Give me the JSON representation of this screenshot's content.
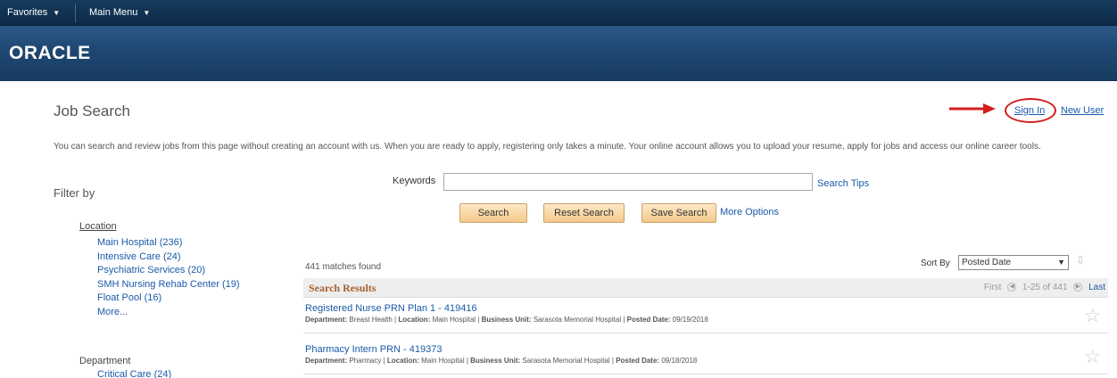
{
  "topnav": {
    "favorites": "Favorites",
    "main_menu": "Main Menu"
  },
  "brand": {
    "logo": "ORACLE"
  },
  "page": {
    "title": "Job Search",
    "sign_in": "Sign In",
    "new_user": "New User",
    "intro": "You can search and review jobs from this page without creating an account with us. When you are ready to apply, registering only takes a minute. Your online account allows you to upload your resume, apply for jobs and access our online career tools."
  },
  "search": {
    "keywords_label": "Keywords",
    "keywords_value": "",
    "search_tips": "Search Tips",
    "search_btn": "Search",
    "reset_btn": "Reset Search",
    "save_btn": "Save Search",
    "more_options": "More Options"
  },
  "filter": {
    "title": "Filter by",
    "location_label": "Location",
    "location_items": [
      "Main Hospital (236)",
      "Intensive Care (24)",
      "Psychiatric Services (20)",
      "SMH Nursing Rehab Center (19)",
      "Float Pool (16)",
      "More..."
    ],
    "department_label": "Department",
    "department_first": "Critical Care (24)"
  },
  "results": {
    "matches": "441 matches found",
    "sort_label": "Sort By",
    "sort_value": "Posted Date",
    "header": "Search Results",
    "pager_first": "First",
    "pager_range": "1-25 of 441",
    "pager_last": "Last",
    "jobs": [
      {
        "title": "Registered Nurse PRN Plan 1 - 419416",
        "department": "Breast Health",
        "location": "Main Hospital",
        "business_unit": "Sarasota Memorial Hospital",
        "posted_date": "09/19/2018"
      },
      {
        "title": "Pharmacy Intern PRN - 419373",
        "department": "Pharmacy",
        "location": "Main Hospital",
        "business_unit": "Sarasota Memorial Hospital",
        "posted_date": "09/18/2018"
      }
    ],
    "labels": {
      "department": "Department:",
      "location": "Location:",
      "business_unit": "Business Unit:",
      "posted_date": "Posted Date:"
    }
  },
  "colors": {
    "accent_red": "#d41c1c",
    "link": "#1a5aa8",
    "header_blue": "#1e4771"
  }
}
